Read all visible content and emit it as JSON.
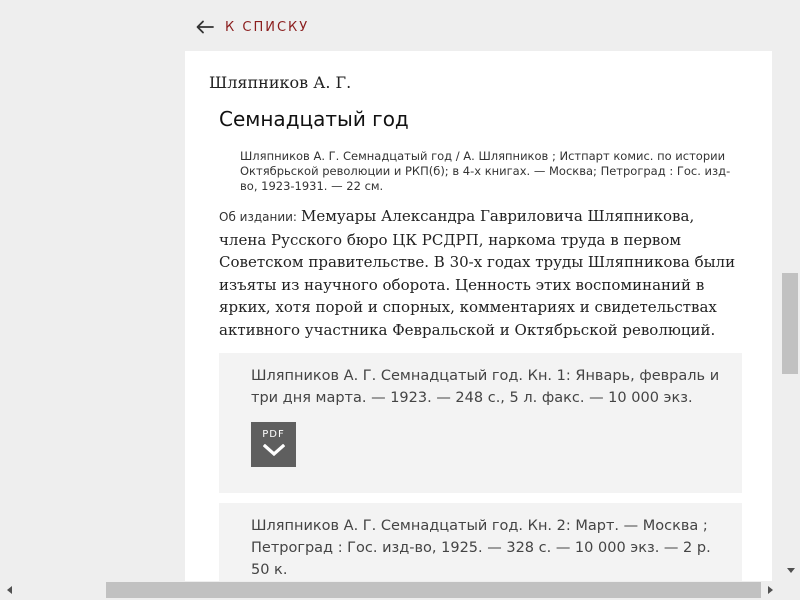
{
  "nav": {
    "back_label": "К СПИСКУ"
  },
  "book": {
    "author": "Шляпников А. Г.",
    "title": "Семнадцатый год",
    "biblio": "Шляпников А. Г. Семнадцатый год / А. Шляпников ; Истпарт комис. по истории Октябрьской революции и РКП(б); в 4-х книгах. — Москва; Петроград : Гос. изд-во, 1923-1931. — 22 см.",
    "about_label": "Об издании:",
    "about_text": "Мемуары Александра Гавриловича Шляпникова, члена Русского бюро ЦК РСДРП, наркома труда в первом Советском правительстве. В 30-х годах труды Шляпникова были изъяты из научного оборота. Ценность этих воспоминаний в ярких, хотя порой и спорных, комментариях и свидетельствах активного участника Февральской и Октябрьской революций."
  },
  "volumes": [
    {
      "text": "Шляпников А. Г. Семнадцатый год. Кн. 1: Январь, февраль и три дня марта. — 1923. — 248 с., 5 л. факс. — 10 000 экз.",
      "pdf_label": "PDF"
    },
    {
      "text": "Шляпников А. Г. Семнадцатый год. Кн. 2: Март. — Москва ; Петроград : Гос. изд-во, 1925. — 328 с. — 10 000 экз. — 2 р. 50 к."
    }
  ],
  "icons": {
    "back": "arrow-left-icon",
    "download": "chevron-down-icon"
  },
  "colors": {
    "accent": "#8b1e1e",
    "pdf_button": "#5f5f5f",
    "volume_bg": "#f3f3f3"
  }
}
